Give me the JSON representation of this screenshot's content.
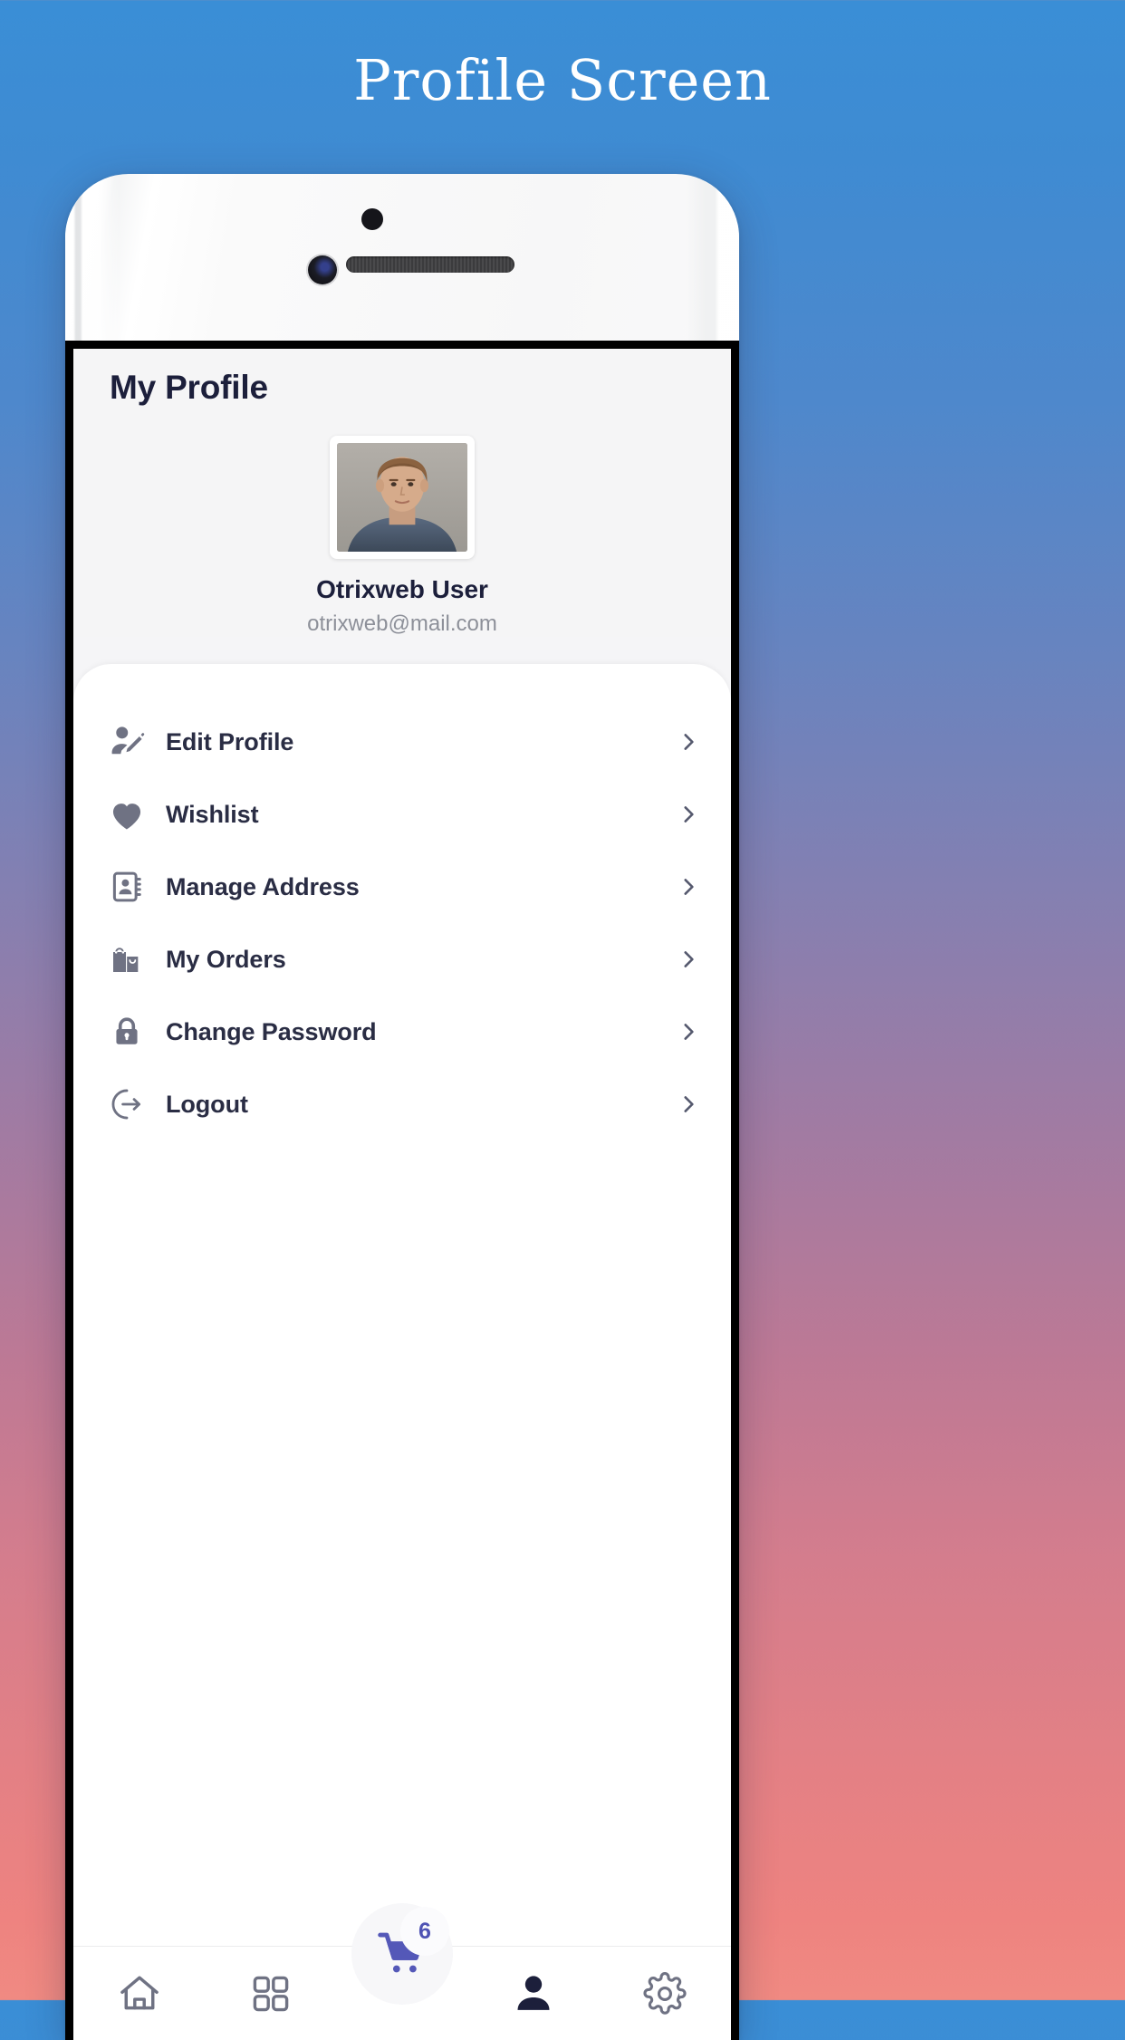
{
  "page": {
    "title": "Profile Screen",
    "background_top_color": "#3a8ed6",
    "background_bottom_color": "#f08a82"
  },
  "screen": {
    "header": {
      "title": "My Profile"
    },
    "profile": {
      "avatar_alt": "user-photo",
      "name": "Otrixweb User",
      "email": "otrixweb@mail.com",
      "name_color": "#1c1f3b",
      "email_color": "#8d9099"
    },
    "menu": {
      "items": [
        {
          "label": "Edit Profile",
          "icon": "edit-profile-icon",
          "chevron": "chevron-right-icon"
        },
        {
          "label": "Wishlist",
          "icon": "heart-icon",
          "chevron": "chevron-right-icon"
        },
        {
          "label": "Manage Address",
          "icon": "address-book-icon",
          "chevron": "chevron-right-icon"
        },
        {
          "label": "My Orders",
          "icon": "shopping-bags-icon",
          "chevron": "chevron-right-icon"
        },
        {
          "label": "Change Password",
          "icon": "lock-icon",
          "chevron": "chevron-right-icon"
        },
        {
          "label": "Logout",
          "icon": "logout-icon",
          "chevron": "chevron-right-icon"
        }
      ],
      "icon_color": "#6f7283",
      "label_color": "#2a2d44"
    },
    "bottom_nav": {
      "items": [
        {
          "name": "home-icon",
          "active": false
        },
        {
          "name": "grid-icon",
          "active": false
        },
        {
          "name": "person-icon",
          "active": true
        },
        {
          "name": "gear-icon",
          "active": false
        }
      ],
      "cart": {
        "icon": "shopping-cart-icon",
        "badge_count": "6",
        "accent_color": "#5458b8"
      },
      "inactive_color": "#6f7283",
      "active_color": "#1c1f3b"
    }
  }
}
